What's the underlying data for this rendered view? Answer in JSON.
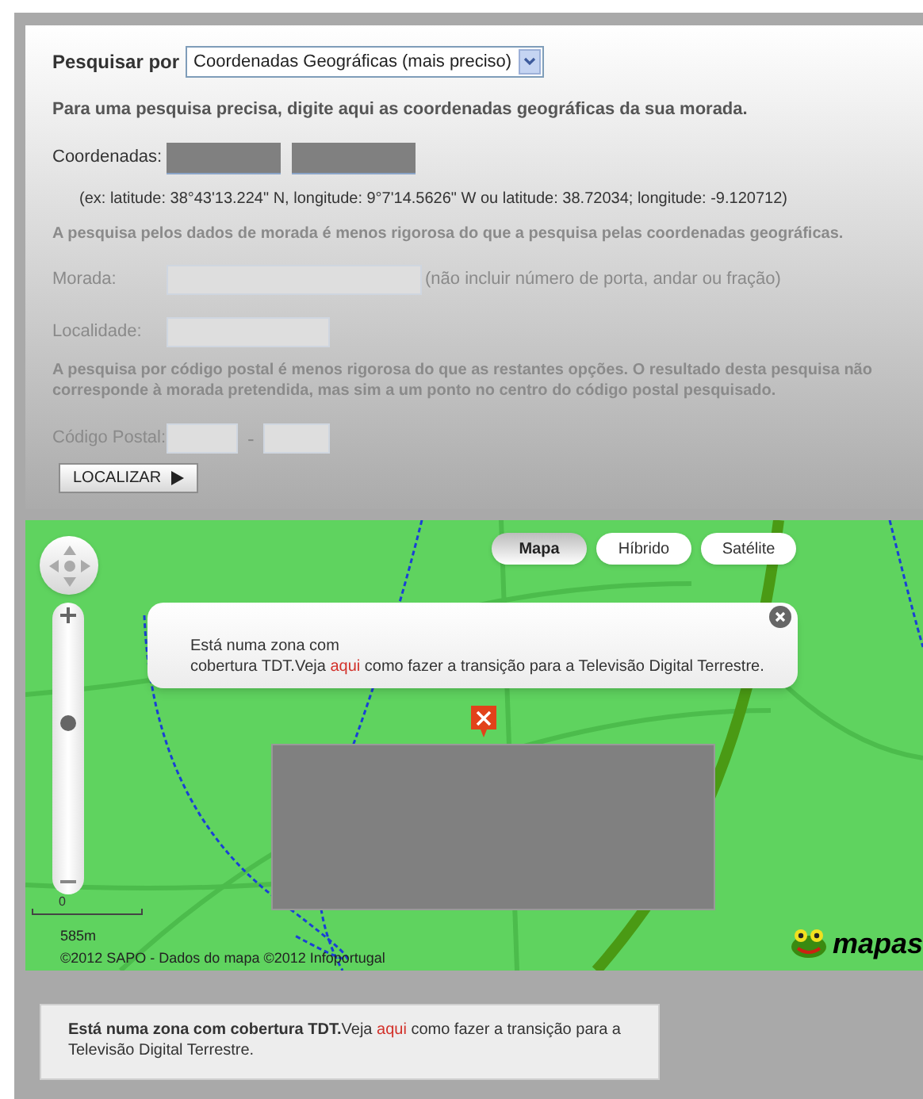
{
  "search_by": {
    "label": "Pesquisar por",
    "value": "Coordenadas Geográficas (mais preciso)"
  },
  "coordinates": {
    "intro": "Para uma pesquisa precisa, digite aqui as coordenadas geográficas da sua morada.",
    "label": "Coordenadas:",
    "example": "(ex: latitude: 38°43'13.224\" N, longitude: 9°7'14.5626\" W ou latitude: 38.72034; longitude: -9.120712)"
  },
  "address": {
    "disabled": true,
    "note": "A pesquisa pelos dados de morada é menos rigorosa do que a pesquisa pelas coordenadas geográficas.",
    "street_label": "Morada:",
    "street_hint": "(não incluir número de porta, andar ou fração)",
    "locality_label": "Localidade:"
  },
  "postal": {
    "disabled": true,
    "note": "A pesquisa por código postal é menos rigorosa do que as restantes opções. O resultado desta pesquisa não corresponde à morada pretendida, mas sim a um ponto no centro do código postal pesquisado.",
    "label": "Código Postal:",
    "separator": "-"
  },
  "locate_button": "LOCALIZAR",
  "map": {
    "types": [
      {
        "label": "Mapa",
        "selected": true
      },
      {
        "label": "Híbrido",
        "selected": false
      },
      {
        "label": "Satélite",
        "selected": false
      }
    ],
    "zoom": {
      "level": 0.62
    },
    "popup": {
      "line_1": "Está numa zona com",
      "before_link": "cobertura TDT.Veja ",
      "link": "aqui",
      "after_link": " como fazer a transição para a Televisão Digital Terrestre."
    },
    "scale_zero": "0",
    "scale_distance": "585m",
    "copyright": "©2012 SAPO - Dados do mapa ©2012 Infoportugal",
    "logo": "mapas"
  },
  "coverage_notice": {
    "before_link": "**Está numa zona com cobertura TDT.**Veja ",
    "link": "aqui",
    "after_link": " como fazer a transição para a Televisão Digital Terrestre."
  }
}
